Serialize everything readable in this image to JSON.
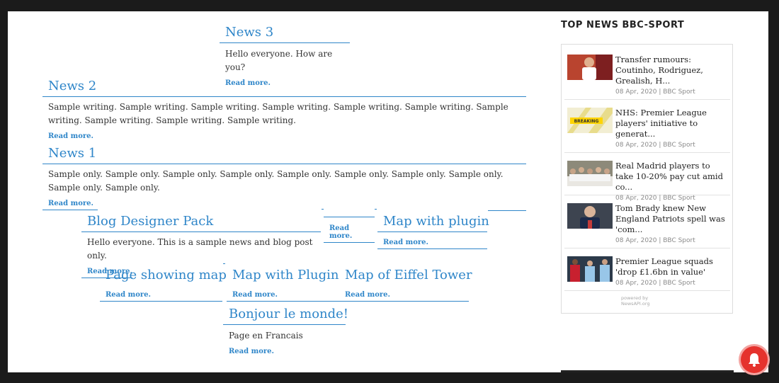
{
  "posts": {
    "news3": {
      "title": "News 3",
      "excerpt": "Hello everyone. How are you?",
      "read_more": "Read more."
    },
    "news2": {
      "title": "News 2",
      "excerpt": "Sample writing. Sample writing. Sample writing. Sample writing. Sample writing. Sample writing. Sample writing. Sample writing. Sample writing. Sample writing.",
      "read_more": "Read more."
    },
    "news1": {
      "title": "News 1",
      "excerpt": "Sample only. Sample only. Sample only. Sample only. Sample only. Sample only. Sample only. Sample only. Sample only. Sample only.",
      "read_more": "Read more."
    },
    "blog_designer": {
      "title": "Blog Designer Pack",
      "excerpt": "Hello everyone. This is a sample news and blog post only.",
      "read_more": "Read more."
    },
    "untitled": {
      "read_more": "Read more."
    },
    "map_plugin_lower": {
      "title": "Map with plugin",
      "read_more": "Read more."
    },
    "page_map": {
      "title": "Page showing map",
      "read_more": "Read more."
    },
    "map_plugin_upper": {
      "title": "Map with Plugin",
      "read_more": "Read more."
    },
    "eiffel": {
      "title": "Map of Eiffel Tower",
      "read_more": "Read more."
    },
    "bonjour": {
      "title": "Bonjour le monde!",
      "excerpt": "Page en Francais",
      "read_more": "Read more."
    }
  },
  "sidebar": {
    "title": "TOP NEWS BBC-SPORT",
    "items": [
      {
        "headline": "Transfer rumours: Coutinho, Rodriguez, Grealish, H...",
        "meta": "08 Apr, 2020 | BBC Sport"
      },
      {
        "headline": "NHS: Premier League players' initiative to generat...",
        "meta": "08 Apr, 2020 | BBC Sport",
        "thumb_text": "BREAKING"
      },
      {
        "headline": "Real Madrid players to take 10-20% pay cut amid co...",
        "meta": "08 Apr, 2020 | BBC Sport"
      },
      {
        "headline": "Tom Brady knew New England Patriots spell was 'com...",
        "meta": "08 Apr, 2020 | BBC Sport"
      },
      {
        "headline": "Premier League squads 'drop £1.6bn in value'",
        "meta": "08 Apr, 2020 | BBC Sport"
      }
    ],
    "powered_line1": "powered by",
    "powered_line2": "NewsAPI.org"
  },
  "colors": {
    "link": "#2f86c9",
    "notification": "#e5322d"
  }
}
